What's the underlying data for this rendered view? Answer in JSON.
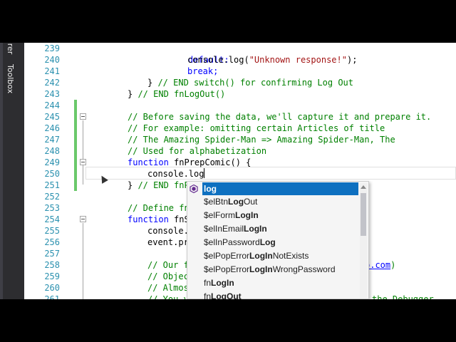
{
  "dock": {
    "explorer_tab": "orer",
    "toolbox_tab": "Toolbox"
  },
  "line_numbers": [
    "239",
    "240",
    "241",
    "242",
    "243",
    "244",
    "245",
    "246",
    "247",
    "248",
    "249",
    "250",
    "251",
    "252",
    "253",
    "254",
    "255",
    "256",
    "257",
    "258",
    "259",
    "260",
    "261"
  ],
  "code": {
    "l239": "default:",
    "l240_a": "console.log(",
    "l240_b": "\"Unknown response!\"",
    "l240_c": ");",
    "l241": "break;",
    "l242_a": "} ",
    "l242_b": "// END switch() for confirming Log Out",
    "l243_a": "} ",
    "l243_b": "// END fnLogOut()",
    "l245": "// Before saving the data, we'll capture it and prepare it.",
    "l246": "// For example: omitting certain Articles of title",
    "l247": "// The Amazing Spider-Man => Amazing Spider-Man, The",
    "l248": "// Used for alphabetization",
    "l249_kw": "function",
    "l249_b": " fnPrepComic() {",
    "l250": "console.log",
    "l251_a": "} ",
    "l251_b": "// END fnP",
    "l253": "// Define fn",
    "l254_kw": "function",
    "l254_b": " fnS",
    "l255": "console.",
    "l256": "event.pr",
    "l258_a": "// Our f",
    "l258_b": "p.com",
    "l258_c": ")",
    "l259": "// Objec",
    "l260": "// Almos",
    "l261_a": "// You v",
    "l261_b": "the Debugger"
  },
  "autocomplete": {
    "items": [
      {
        "pre": "",
        "match": "log",
        "post": ""
      },
      {
        "pre": "$elBtn",
        "match": "Log",
        "post": "Out"
      },
      {
        "pre": "$elForm",
        "match": "LogIn",
        "post": ""
      },
      {
        "pre": "$elInEmail",
        "match": "LogIn",
        "post": ""
      },
      {
        "pre": "$elInPassword",
        "match": "Log",
        "post": ""
      },
      {
        "pre": "$elPopError",
        "match": "LogIn",
        "post": "NotExists"
      },
      {
        "pre": "$elPopError",
        "match": "LogIn",
        "post": "WrongPassword"
      },
      {
        "pre": "fn",
        "match": "LogIn",
        "post": ""
      },
      {
        "pre": "fn",
        "match": "LogOut",
        "post": ""
      }
    ],
    "selected_index": 0,
    "colors": {
      "selection": "#0e70c0",
      "icon": "#652d90"
    }
  },
  "colors": {
    "keyword": "#0000ff",
    "string": "#a31515",
    "comment": "#008000",
    "line_number": "#2b91af",
    "change_bar": "#6ac86a"
  }
}
